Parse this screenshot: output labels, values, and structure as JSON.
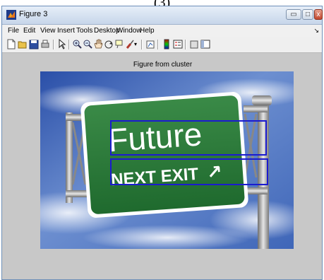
{
  "caption_fragment": "(3)",
  "window": {
    "title": "Figure 3"
  },
  "title_buttons": {
    "minimize": "▭",
    "maximize": "□",
    "close": "x"
  },
  "menu": {
    "items": [
      "File",
      "Edit",
      "View",
      "Insert",
      "Tools",
      "Desktop",
      "Window",
      "Help"
    ],
    "overflow_arrow": "↘"
  },
  "toolbar": {
    "icons": [
      "new-figure-icon",
      "open-file-icon",
      "save-icon",
      "print-icon",
      "edit-plot-arrow-icon",
      "zoom-in-icon",
      "zoom-out-icon",
      "pan-hand-icon",
      "rotate-3d-icon",
      "data-cursor-icon",
      "brush-icon",
      "link-plot-icon",
      "insert-colorbar-icon",
      "insert-legend-icon",
      "hide-plot-tools-icon",
      "show-plot-tools-icon"
    ]
  },
  "figure": {
    "axes_title": "Figure from cluster",
    "sign": {
      "top_text": "Future",
      "bottom_text": "NEXT EXIT",
      "arrow": "↗"
    },
    "detection_box_color": "#1b1bd0",
    "sign_color": "#2e7a3c"
  }
}
